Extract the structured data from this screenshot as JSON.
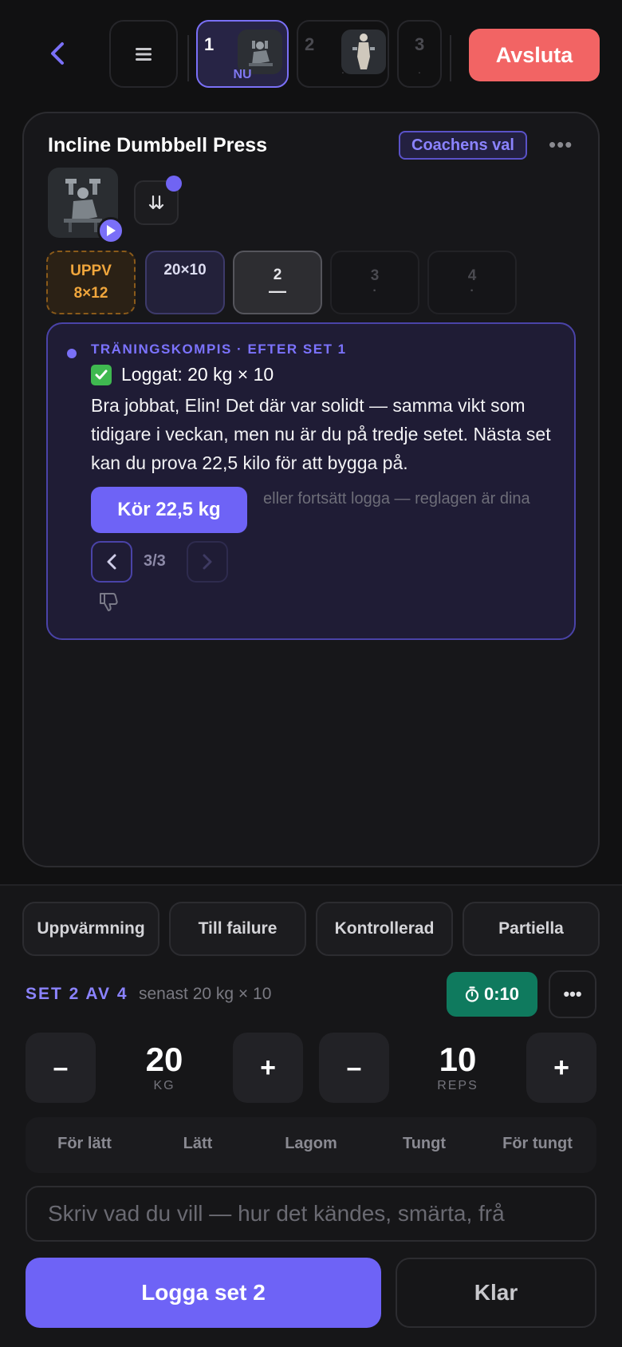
{
  "header": {
    "exercise_tabs": [
      {
        "number": "1",
        "sub": "NU"
      },
      {
        "number": "2",
        "sub": "·"
      },
      {
        "number": "3",
        "sub": "·"
      }
    ],
    "exit_label": "Avsluta"
  },
  "card": {
    "title": "Incline Dumbbell Press",
    "badge": "Coachens val",
    "sets": [
      {
        "line1": "UPPV",
        "line2": "8×12"
      },
      {
        "line1": "20×10"
      },
      {
        "line1": "2",
        "line2": "—"
      },
      {
        "line1": "3",
        "line2": "·"
      },
      {
        "line1": "4",
        "line2": "·"
      }
    ]
  },
  "companion": {
    "heading": "TRÄNINGSKOMPIS · EFTER SET 1",
    "logged": "Loggat: 20 kg × 10",
    "message": "Bra jobbat, Elin! Det där var solidt — samma vikt som tidigare i veckan, men nu är du på tredje setet. Nästa set kan du prova 22,5 kilo för att bygga på.",
    "action_label": "Kör 22,5 kg",
    "hint": "eller fortsätt logga — reglagen är dina",
    "pager": "3/3"
  },
  "panel": {
    "tags": [
      "Uppvärmning",
      "Till failure",
      "Kontrollerad",
      "Partiella"
    ],
    "set_label": "SET 2 AV 4",
    "last_label": "senast 20 kg × 10",
    "timer": "0:10",
    "weight": {
      "value": "20",
      "unit": "KG"
    },
    "reps": {
      "value": "10",
      "unit": "REPS"
    },
    "feel_options": [
      "För lätt",
      "Lätt",
      "Lagom",
      "Tungt",
      "För tungt"
    ],
    "note_placeholder": "Skriv vad du vill — hur det kändes, smärta, frå",
    "log_label": "Logga set 2",
    "done_label": "Klar"
  },
  "colors": {
    "accent": "#6e63f6",
    "exit": "#f26464",
    "timer": "#0f7a5e",
    "warmup": "#f0a63c"
  }
}
